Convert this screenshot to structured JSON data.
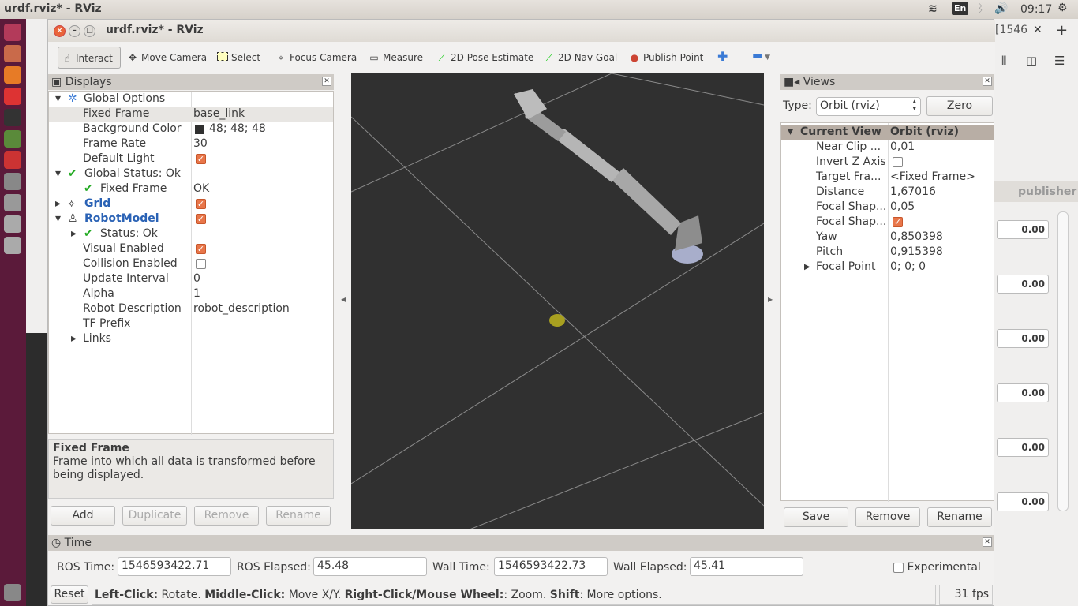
{
  "os": {
    "title": "urdf.rviz* - RViz",
    "lang": "En",
    "clock": "09:17"
  },
  "browser_bg": {
    "tab": "[1546",
    "publisher_tab": "publisher",
    "values": [
      "0.00",
      "0.00",
      "0.00",
      "0.00",
      "0.00",
      "0.00"
    ]
  },
  "window": {
    "title": "urdf.rviz* - RViz"
  },
  "toolbar": {
    "items": [
      {
        "label": "Interact",
        "icon": "hand-icon"
      },
      {
        "label": "Move Camera",
        "icon": "move-arrows-icon"
      },
      {
        "label": "Select",
        "icon": "select-box-icon"
      },
      {
        "label": "Focus Camera",
        "icon": "crosshair-icon"
      },
      {
        "label": "Measure",
        "icon": "ruler-icon"
      },
      {
        "label": "2D Pose Estimate",
        "icon": "green-arrow-icon"
      },
      {
        "label": "2D Nav Goal",
        "icon": "green-arrow-icon"
      },
      {
        "label": "Publish Point",
        "icon": "map-pin-icon"
      }
    ]
  },
  "displays": {
    "title": "Displays",
    "rows": [
      {
        "k": "Global Options",
        "v": ""
      },
      {
        "k": "Fixed Frame",
        "v": "base_link"
      },
      {
        "k": "Background Color",
        "v": "48; 48; 48"
      },
      {
        "k": "Frame Rate",
        "v": "30"
      },
      {
        "k": "Default Light",
        "v": ""
      },
      {
        "k": "Global Status: Ok",
        "v": ""
      },
      {
        "k": "Fixed Frame",
        "v": "OK"
      },
      {
        "k": "Grid",
        "v": ""
      },
      {
        "k": "RobotModel",
        "v": ""
      },
      {
        "k": "Status: Ok",
        "v": ""
      },
      {
        "k": "Visual Enabled",
        "v": ""
      },
      {
        "k": "Collision Enabled",
        "v": ""
      },
      {
        "k": "Update Interval",
        "v": "0"
      },
      {
        "k": "Alpha",
        "v": "1"
      },
      {
        "k": "Robot Description",
        "v": "robot_description"
      },
      {
        "k": "TF Prefix",
        "v": ""
      },
      {
        "k": "Links",
        "v": ""
      }
    ],
    "help_title": "Fixed Frame",
    "help_text": "Frame into which all data is transformed before being displayed.",
    "buttons": {
      "add": "Add",
      "duplicate": "Duplicate",
      "remove": "Remove",
      "rename": "Rename"
    }
  },
  "views": {
    "title": "Views",
    "type_label": "Type:",
    "type_value": "Orbit (rviz)",
    "zero": "Zero",
    "header": {
      "k": "Current View",
      "v": "Orbit (rviz)"
    },
    "rows": [
      {
        "k": "Near Clip ...",
        "v": "0,01"
      },
      {
        "k": "Invert Z Axis",
        "v": ""
      },
      {
        "k": "Target Fra...",
        "v": "<Fixed Frame>"
      },
      {
        "k": "Distance",
        "v": "1,67016"
      },
      {
        "k": "Focal Shap...",
        "v": "0,05"
      },
      {
        "k": "Focal Shap...",
        "v": ""
      },
      {
        "k": "Yaw",
        "v": "0,850398"
      },
      {
        "k": "Pitch",
        "v": "0,915398"
      },
      {
        "k": "Focal Point",
        "v": "0; 0; 0"
      }
    ],
    "buttons": {
      "save": "Save",
      "remove": "Remove",
      "rename": "Rename"
    }
  },
  "time": {
    "title": "Time",
    "ros_time_label": "ROS Time:",
    "ros_time": "1546593422.71",
    "ros_elapsed_label": "ROS Elapsed:",
    "ros_elapsed": "45.48",
    "wall_time_label": "Wall Time:",
    "wall_time": "1546593422.73",
    "wall_elapsed_label": "Wall Elapsed:",
    "wall_elapsed": "45.41",
    "experimental": "Experimental"
  },
  "status": {
    "reset": "Reset",
    "b1": "Left-Click:",
    "t1": " Rotate. ",
    "b2": "Middle-Click:",
    "t2": " Move X/Y. ",
    "b3": "Right-Click/Mouse Wheel:",
    "t3": ": Zoom. ",
    "b4": "Shift",
    "t4": ": More options.",
    "fps": "31 fps"
  },
  "colors": {
    "viewport_bg": "#303030",
    "checkbox": "#e8764a",
    "launcher": "#5b1a3a"
  }
}
